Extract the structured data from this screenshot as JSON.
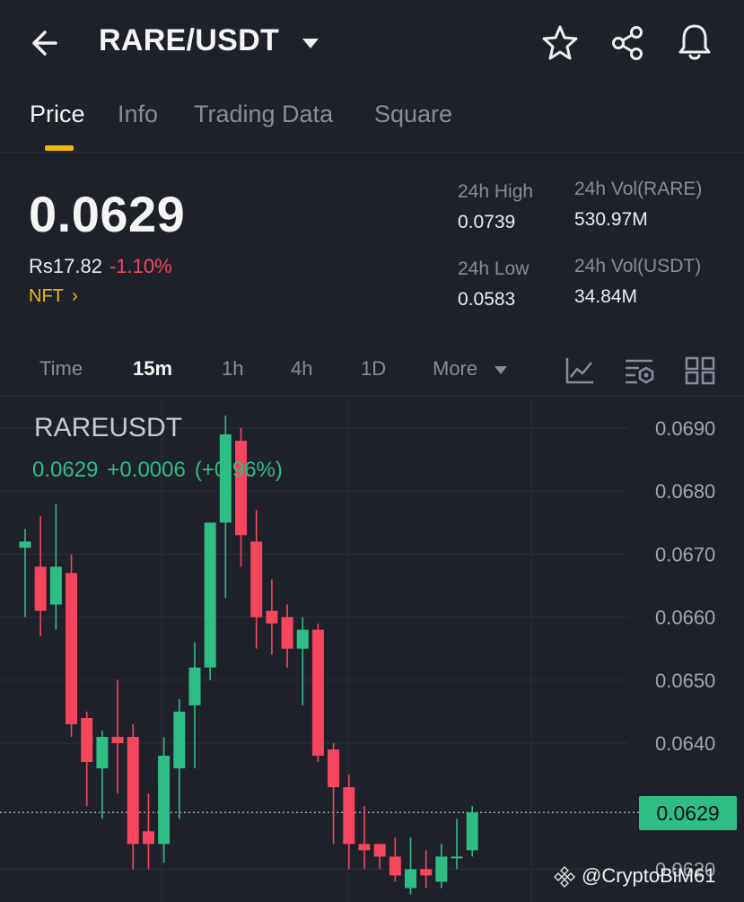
{
  "header": {
    "pair": "RARE/USDT",
    "icons": [
      "back-arrow-icon",
      "caret-down-icon",
      "star-icon",
      "share-icon",
      "bell-icon"
    ]
  },
  "tabs": [
    {
      "label": "Price",
      "active": true
    },
    {
      "label": "Info",
      "active": false
    },
    {
      "label": "Trading Data",
      "active": false
    },
    {
      "label": "Square",
      "active": false
    }
  ],
  "price": {
    "last": "0.0629",
    "fiat": "Rs17.82",
    "change_pct": "-1.10%",
    "tag": "NFT",
    "tag_chevron": "›"
  },
  "stats": {
    "high_label": "24h High",
    "high_value": "0.0739",
    "low_label": "24h Low",
    "low_value": "0.0583",
    "vol_base_label": "24h Vol(RARE)",
    "vol_base_value": "530.97M",
    "vol_quote_label": "24h Vol(USDT)",
    "vol_quote_value": "34.84M"
  },
  "intervals": {
    "items": [
      {
        "label": "Time",
        "active": false
      },
      {
        "label": "15m",
        "active": true
      },
      {
        "label": "1h",
        "active": false
      },
      {
        "label": "4h",
        "active": false
      },
      {
        "label": "1D",
        "active": false
      }
    ],
    "more": "More",
    "tools": [
      "indicator-icon",
      "chart-settings-icon",
      "layout-grid-icon"
    ]
  },
  "colors": {
    "up": "#2ebd85",
    "down": "#f6465d",
    "accent": "#f0b90b",
    "background": "#1e2129"
  },
  "chart_data": {
    "type": "candlestick",
    "symbol": "RAREUSDT",
    "quote_price": "0.0629",
    "quote_change": "+0.0006",
    "quote_change_pct": "(+0.96%)",
    "current_price": "0.0629",
    "y_ticks": [
      "0.0690",
      "0.0680",
      "0.0670",
      "0.0660",
      "0.0650",
      "0.0640",
      "0.0620"
    ],
    "ylim": [
      0.0619,
      0.0697
    ],
    "grid": true,
    "candles": [
      {
        "o": 0.0671,
        "h": 0.0674,
        "l": 0.066,
        "c": 0.0672
      },
      {
        "o": 0.0668,
        "h": 0.0676,
        "l": 0.0657,
        "c": 0.0661
      },
      {
        "o": 0.0662,
        "h": 0.0678,
        "l": 0.0658,
        "c": 0.0668
      },
      {
        "o": 0.0667,
        "h": 0.067,
        "l": 0.0641,
        "c": 0.0643
      },
      {
        "o": 0.0644,
        "h": 0.0645,
        "l": 0.063,
        "c": 0.0637
      },
      {
        "o": 0.0636,
        "h": 0.0642,
        "l": 0.0628,
        "c": 0.0641
      },
      {
        "o": 0.0641,
        "h": 0.065,
        "l": 0.0632,
        "c": 0.064
      },
      {
        "o": 0.0641,
        "h": 0.0643,
        "l": 0.062,
        "c": 0.0624
      },
      {
        "o": 0.0626,
        "h": 0.0632,
        "l": 0.062,
        "c": 0.0624
      },
      {
        "o": 0.0624,
        "h": 0.0641,
        "l": 0.0621,
        "c": 0.0638
      },
      {
        "o": 0.0636,
        "h": 0.0647,
        "l": 0.0628,
        "c": 0.0645
      },
      {
        "o": 0.0646,
        "h": 0.0656,
        "l": 0.0636,
        "c": 0.0652
      },
      {
        "o": 0.0652,
        "h": 0.0673,
        "l": 0.065,
        "c": 0.0675
      },
      {
        "o": 0.0675,
        "h": 0.0692,
        "l": 0.0663,
        "c": 0.0689
      },
      {
        "o": 0.0688,
        "h": 0.069,
        "l": 0.0668,
        "c": 0.0673
      },
      {
        "o": 0.0672,
        "h": 0.0677,
        "l": 0.0655,
        "c": 0.066
      },
      {
        "o": 0.0661,
        "h": 0.0666,
        "l": 0.0654,
        "c": 0.0659
      },
      {
        "o": 0.066,
        "h": 0.0662,
        "l": 0.0652,
        "c": 0.0655
      },
      {
        "o": 0.0655,
        "h": 0.066,
        "l": 0.0646,
        "c": 0.0658
      },
      {
        "o": 0.0658,
        "h": 0.0659,
        "l": 0.0637,
        "c": 0.0638
      },
      {
        "o": 0.0639,
        "h": 0.064,
        "l": 0.0624,
        "c": 0.0633
      },
      {
        "o": 0.0633,
        "h": 0.0635,
        "l": 0.062,
        "c": 0.0624
      },
      {
        "o": 0.0624,
        "h": 0.063,
        "l": 0.062,
        "c": 0.0623
      },
      {
        "o": 0.0624,
        "h": 0.0624,
        "l": 0.062,
        "c": 0.0622
      },
      {
        "o": 0.0622,
        "h": 0.0625,
        "l": 0.0618,
        "c": 0.0619
      },
      {
        "o": 0.0617,
        "h": 0.0625,
        "l": 0.0616,
        "c": 0.062
      },
      {
        "o": 0.062,
        "h": 0.0623,
        "l": 0.0617,
        "c": 0.0619
      },
      {
        "o": 0.0618,
        "h": 0.0624,
        "l": 0.0617,
        "c": 0.0622
      },
      {
        "o": 0.0622,
        "h": 0.0628,
        "l": 0.062,
        "c": 0.0622
      },
      {
        "o": 0.0623,
        "h": 0.063,
        "l": 0.0622,
        "c": 0.0629
      }
    ]
  },
  "watermark": {
    "text": "@CryptoBiM61",
    "icon": "binance-logo-icon"
  }
}
